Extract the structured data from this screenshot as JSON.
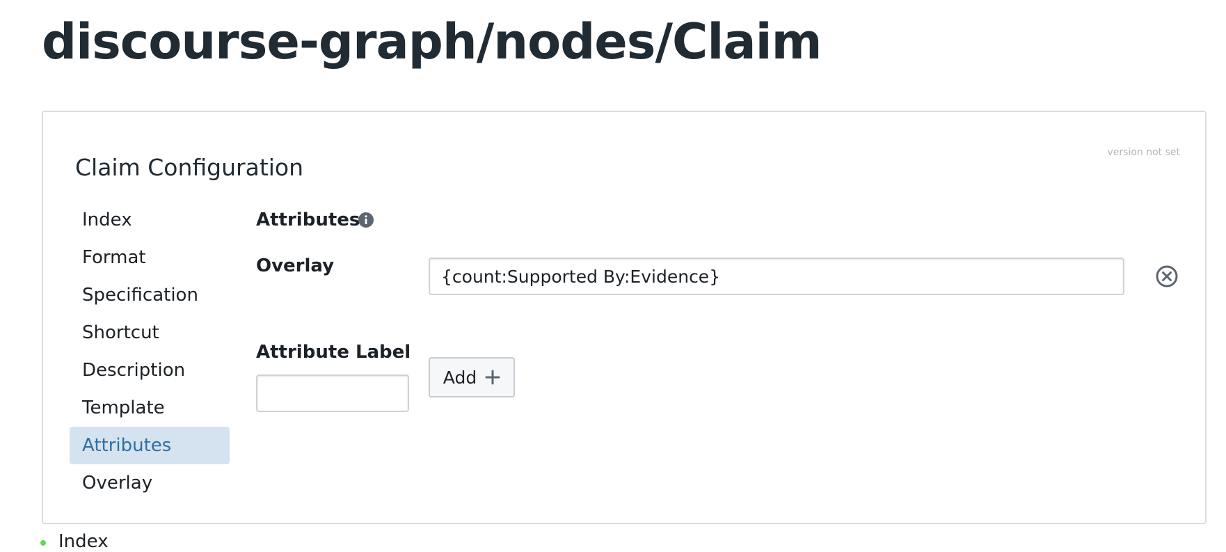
{
  "page": {
    "title": "discourse-graph/nodes/Claim"
  },
  "panel": {
    "title": "Claim Configuration",
    "version": "version not set",
    "tabs": [
      {
        "label": "Index",
        "active": false
      },
      {
        "label": "Format",
        "active": false
      },
      {
        "label": "Specification",
        "active": false
      },
      {
        "label": "Shortcut",
        "active": false
      },
      {
        "label": "Description",
        "active": false
      },
      {
        "label": "Template",
        "active": false
      },
      {
        "label": "Attributes",
        "active": true
      },
      {
        "label": "Overlay",
        "active": false
      }
    ]
  },
  "attributes": {
    "section_title": "Attributes",
    "info_icon": "info-icon",
    "overlay_label": "Overlay",
    "overlay_value": "{count:Supported By:Evidence}",
    "remove_icon": "circle-x-icon",
    "attribute_label_title": "Attribute Label",
    "attribute_label_value": "",
    "add_button_label": "Add",
    "add_icon": "plus-icon"
  },
  "below": {
    "bullet_item": "Index"
  },
  "colors": {
    "active_tab_bg": "#d5e3f0",
    "active_tab_text": "#2f6fa3",
    "bullet": "#5fd85a"
  }
}
